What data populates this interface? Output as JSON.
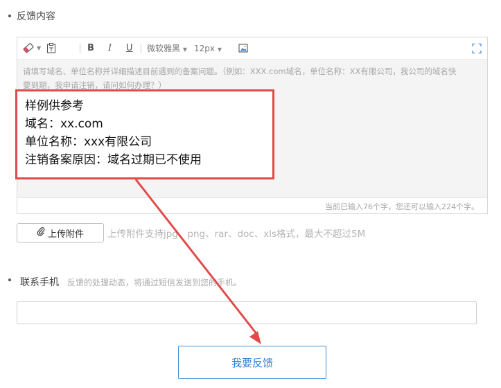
{
  "feedback": {
    "label": "反馈内容",
    "toolbar": {
      "eraser_icon": "eraser-icon",
      "format_icon": "paste-format-icon",
      "bold": "B",
      "italic": "I",
      "underline": "U",
      "font_family": "微软雅黑",
      "font_size": "12px",
      "image_icon": "image-icon",
      "fullscreen_icon": "fullscreen-icon"
    },
    "placeholder_line1": "请填写域名、单位名称并详细描述目前遇到的备案问题。（例如：XXX.com域名，单位名称：XX有限公司，我公司的域名快",
    "placeholder_line2": "要到期，我申请注销，请问如何办理？）",
    "counter": "当前已输入76个字，您还可以输入224个字。"
  },
  "callout": {
    "lines": [
      "样例供参考",
      "域名：xx.com",
      "单位名称：xxx有限公司",
      "注销备案原因：域名过期已不使用"
    ],
    "border_color": "#e24a4a"
  },
  "attachment": {
    "button_label": "上传附件",
    "hint": "上传附件支持jpg、png、rar、doc、xls格式，最大不超过5M"
  },
  "phone": {
    "label": "联系手机",
    "hint": "反馈的处理动态，将通过短信发送到您的手机。",
    "value": ""
  },
  "submit": {
    "label": "我要反馈",
    "color": "#2d7fd1"
  }
}
